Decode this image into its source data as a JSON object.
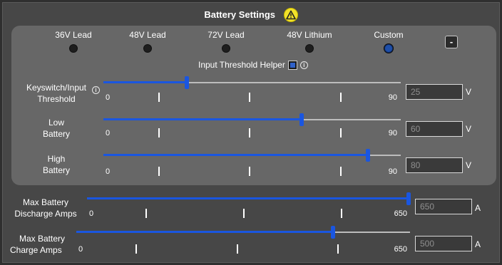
{
  "header": {
    "title": "Battery Settings",
    "warning_icon": "warning-icon"
  },
  "presets": [
    {
      "label": "36V Lead",
      "selected": false
    },
    {
      "label": "48V Lead",
      "selected": false
    },
    {
      "label": "72V Lead",
      "selected": false
    },
    {
      "label": "48V Lithium",
      "selected": false
    },
    {
      "label": "Custom",
      "selected": true
    }
  ],
  "collapse_button": {
    "label": "-"
  },
  "helper": {
    "label": "Input Threshold Helper",
    "checked": true
  },
  "thresholds": [
    {
      "label_line1": "Keyswitch/Input",
      "label_line2": "Threshold",
      "has_info": true,
      "min": "0",
      "max": "90",
      "value": "25",
      "fraction": 0.28,
      "unit": "V"
    },
    {
      "label_line1": "Low",
      "label_line2": "Battery",
      "has_info": false,
      "min": "0",
      "max": "90",
      "value": "60",
      "fraction": 0.667,
      "unit": "V"
    },
    {
      "label_line1": "High",
      "label_line2": "Battery",
      "has_info": false,
      "min": "0",
      "max": "90",
      "value": "80",
      "fraction": 0.889,
      "unit": "V"
    }
  ],
  "amps": [
    {
      "label_line1": "Max Battery",
      "label_line2": "Discharge Amps",
      "min": "0",
      "max": "650",
      "value": "650",
      "fraction": 1.0,
      "unit": "A"
    },
    {
      "label_line1": "Max Battery",
      "label_line2": "Charge Amps",
      "min": "0",
      "max": "650",
      "value": "500",
      "fraction": 0.769,
      "unit": "A"
    }
  ],
  "colors": {
    "accent": "#1a56e0",
    "warning": "#f2e22a",
    "panel": "#676767",
    "background": "#474747"
  }
}
